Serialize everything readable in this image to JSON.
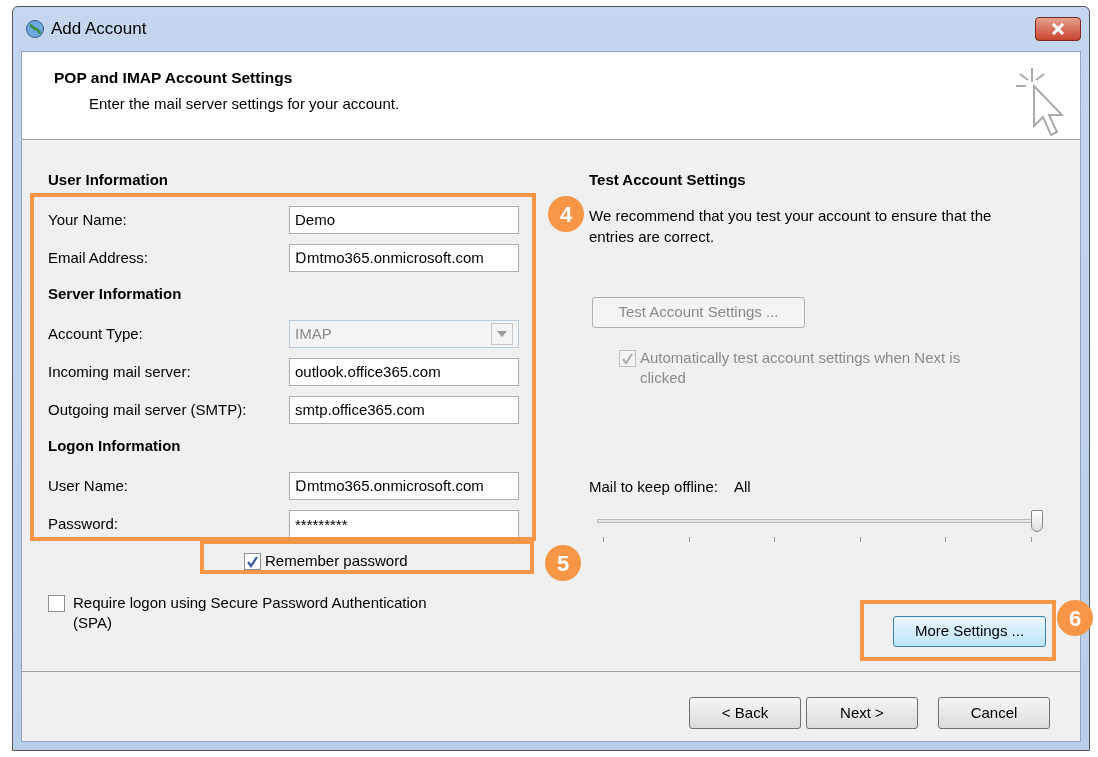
{
  "window": {
    "title": "Add Account"
  },
  "header": {
    "title": "POP and IMAP Account Settings",
    "subtitle": "Enter the mail server settings for your account."
  },
  "sections": [
    {
      "heading": "User Information",
      "fields": [
        {
          "label": "Your Name:",
          "kind": "text",
          "value": "Demo"
        },
        {
          "label": "Email Address:",
          "kind": "text",
          "value": "Ɒmtmo365.onmicrosoft.com"
        }
      ]
    },
    {
      "heading": "Server Information",
      "fields": [
        {
          "label": "Account Type:",
          "kind": "dropdown",
          "value": "IMAP",
          "disabled": true
        },
        {
          "label": "Incoming mail server:",
          "kind": "text",
          "value": "outlook.office365.com"
        },
        {
          "label": "Outgoing mail server (SMTP):",
          "kind": "text",
          "value": "smtp.office365.com"
        }
      ]
    },
    {
      "heading": "Logon Information",
      "fields": [
        {
          "label": "User Name:",
          "kind": "text",
          "value": "Ɒmtmo365.onmicrosoft.com"
        },
        {
          "label": "Password:",
          "kind": "password",
          "value": "*********"
        }
      ]
    }
  ],
  "remember_password": {
    "label": "Remember password",
    "checked": true
  },
  "spa": {
    "label": "Require logon using Secure Password Authentication (SPA)",
    "checked": false
  },
  "test": {
    "heading": "Test Account Settings",
    "description": "We recommend that you test your account to ensure that the entries are correct.",
    "button": {
      "label": "Test Account Settings ...",
      "disabled": true
    },
    "auto_test": {
      "label": "Automatically test account settings when Next is clicked",
      "checked": true,
      "disabled": true
    }
  },
  "offline": {
    "label": "Mail to keep offline:",
    "value": "All",
    "level": 1
  },
  "more_settings": {
    "label": "More Settings ..."
  },
  "buttons": [
    {
      "label": "< Back"
    },
    {
      "label": "Next >"
    },
    {
      "label": "Cancel"
    }
  ],
  "callouts": [
    {
      "number": "4"
    },
    {
      "number": "5"
    },
    {
      "number": "6"
    }
  ]
}
